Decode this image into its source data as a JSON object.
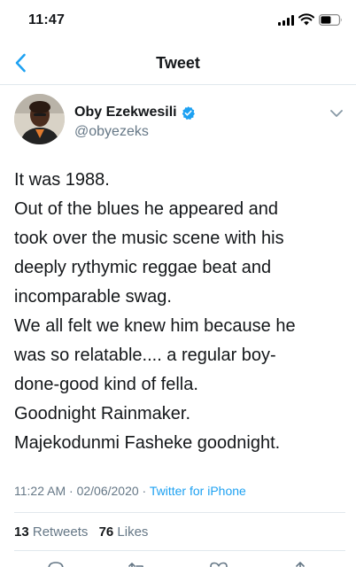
{
  "status_bar": {
    "time": "11:47"
  },
  "nav": {
    "title": "Tweet",
    "back_icon": "chevron-left-icon"
  },
  "author": {
    "name": "Oby Ezekwesili",
    "handle": "@obyezeks",
    "verified": true
  },
  "tweet": {
    "lines": [
      "It was 1988.",
      "Out of the blues he appeared and",
      "took over the music scene with his",
      "deeply rythymic reggae beat and",
      "incomparable swag.",
      "We all felt we knew him because he",
      "was so relatable.... a regular boy-",
      "done-good kind of fella.",
      "Goodnight Rainmaker.",
      "Majekodunmi Fasheke goodnight."
    ],
    "time": "11:22 AM",
    "separator": " · ",
    "date": "02/06/2020",
    "source": "Twitter for iPhone"
  },
  "stats": {
    "retweets_count": "13",
    "retweets_label": " Retweets",
    "likes_count": "76",
    "likes_label": " Likes"
  },
  "colors": {
    "accent": "#1da1f2",
    "secondary_text": "#657786",
    "divider": "#e1e8ed"
  },
  "icons": {
    "actions": [
      "reply-icon",
      "retweet-icon",
      "like-icon",
      "share-icon"
    ]
  }
}
